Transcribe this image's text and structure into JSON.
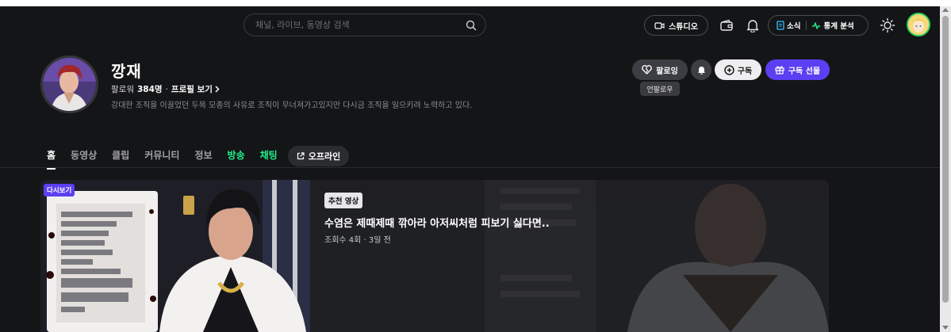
{
  "header": {
    "search_placeholder": "채널, 라이브, 동영상 검색",
    "studio_label": "스튜디오",
    "news_label": "소식",
    "stats_label": "통계 분석"
  },
  "profile": {
    "channel_name": "깡재",
    "followers_label": "팔로워",
    "followers_count": "384명",
    "separator": "·",
    "profile_link": "프로필 보기",
    "description": "강대한 조직을 이끌었던 두목 모종의 사유로 조직이 무너져가고있지만 다시금 조직을 일으키려 노력하고 있다."
  },
  "actions": {
    "follow_label": "팔로잉",
    "subscribe_label": "구독",
    "gift_label": "구독 선물",
    "tooltip": "언팔로우"
  },
  "tabs": [
    {
      "label": "홈"
    },
    {
      "label": "동영상"
    },
    {
      "label": "클립"
    },
    {
      "label": "커뮤니티"
    },
    {
      "label": "정보"
    },
    {
      "label": "방송"
    },
    {
      "label": "채팅"
    }
  ],
  "offline_label": "오프라인",
  "featured": {
    "replay_badge": "다시보기",
    "rec_badge": "추천 영상",
    "title": "수염은 제때제때 깎아라 아저씨처럼 피보기 싫다면..",
    "meta": "조회수 4회 · 3일 전"
  },
  "colors": {
    "background": "#141517",
    "accent_purple": "#5b3ff2",
    "accent_green": "#22ef8b",
    "avatar_ring": "#2fd35b"
  }
}
